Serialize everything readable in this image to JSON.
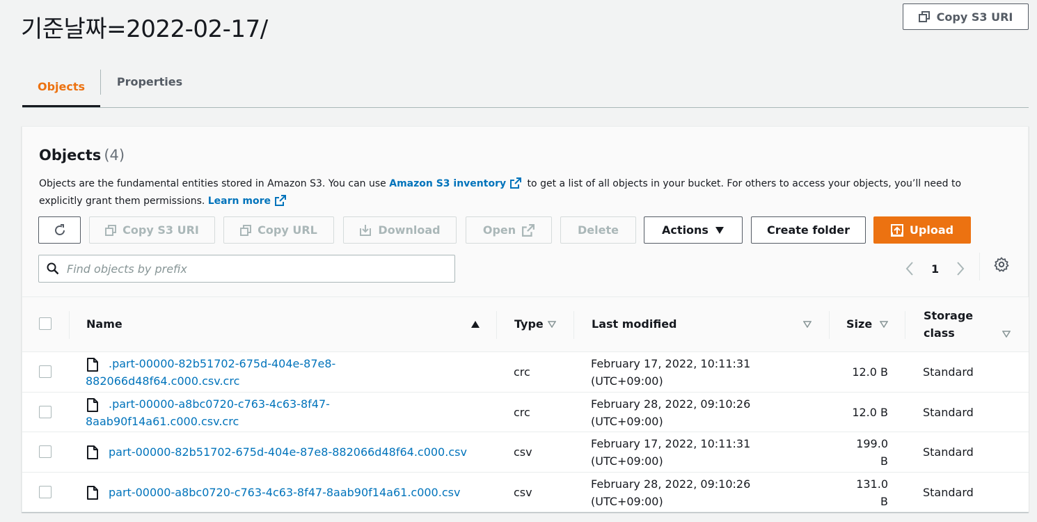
{
  "header": {
    "title": "기준날짜=2022-02-17/",
    "copy_s3_uri_label": "Copy S3 URI"
  },
  "tabs": [
    {
      "label": "Objects",
      "active": true
    },
    {
      "label": "Properties",
      "active": false
    }
  ],
  "objects_panel": {
    "heading": "Objects",
    "count": "(4)",
    "description_part1": "Objects are the fundamental entities stored in Amazon S3. You can use ",
    "inventory_link": "Amazon S3 inventory",
    "description_part2": " to get a list of all objects in your bucket. For others to access your objects, you’ll need to explicitly grant them permissions. ",
    "learn_more_link": "Learn more"
  },
  "toolbar": {
    "refresh_icon": "refresh-icon",
    "copy_s3_uri": "Copy S3 URI",
    "copy_url": "Copy URL",
    "download": "Download",
    "open": "Open",
    "delete": "Delete",
    "actions": "Actions",
    "create_folder": "Create folder",
    "upload": "Upload"
  },
  "search": {
    "placeholder": "Find objects by prefix",
    "value": ""
  },
  "pagination": {
    "current_page": "1"
  },
  "table": {
    "columns": {
      "name": "Name",
      "type": "Type",
      "last_modified": "Last modified",
      "size": "Size",
      "storage_class_line1": "Storage",
      "storage_class_line2": "class"
    },
    "rows": [
      {
        "name_line1": ".part-00000-82b51702-675d-404e-87e8-",
        "name_line2": "882066d48f64.c000.csv.crc",
        "type": "crc",
        "modified_line1": "February 17, 2022, 10:11:31",
        "modified_line2": "(UTC+09:00)",
        "size_line1": "12.0 B",
        "size_line2": "",
        "storage_class": "Standard"
      },
      {
        "name_line1": ".part-00000-a8bc0720-c763-4c63-8f47-",
        "name_line2": "8aab90f14a61.c000.csv.crc",
        "type": "crc",
        "modified_line1": "February 28, 2022, 09:10:26",
        "modified_line2": "(UTC+09:00)",
        "size_line1": "12.0 B",
        "size_line2": "",
        "storage_class": "Standard"
      },
      {
        "name_line1": "part-00000-82b51702-675d-404e-87e8-882066d48f64.c000.csv",
        "name_line2": "",
        "type": "csv",
        "modified_line1": "February 17, 2022, 10:11:31",
        "modified_line2": "(UTC+09:00)",
        "size_line1": "199.0",
        "size_line2": "B",
        "storage_class": "Standard"
      },
      {
        "name_line1": "part-00000-a8bc0720-c763-4c63-8f47-8aab90f14a61.c000.csv",
        "name_line2": "",
        "type": "csv",
        "modified_line1": "February 28, 2022, 09:10:26",
        "modified_line2": "(UTC+09:00)",
        "size_line1": "131.0",
        "size_line2": "B",
        "storage_class": "Standard"
      }
    ]
  },
  "colors": {
    "accent_orange": "#ec7211",
    "link_blue": "#0073bb",
    "text_dark": "#16191f",
    "text_secondary": "#545b64",
    "disabled": "#aab7b8"
  }
}
